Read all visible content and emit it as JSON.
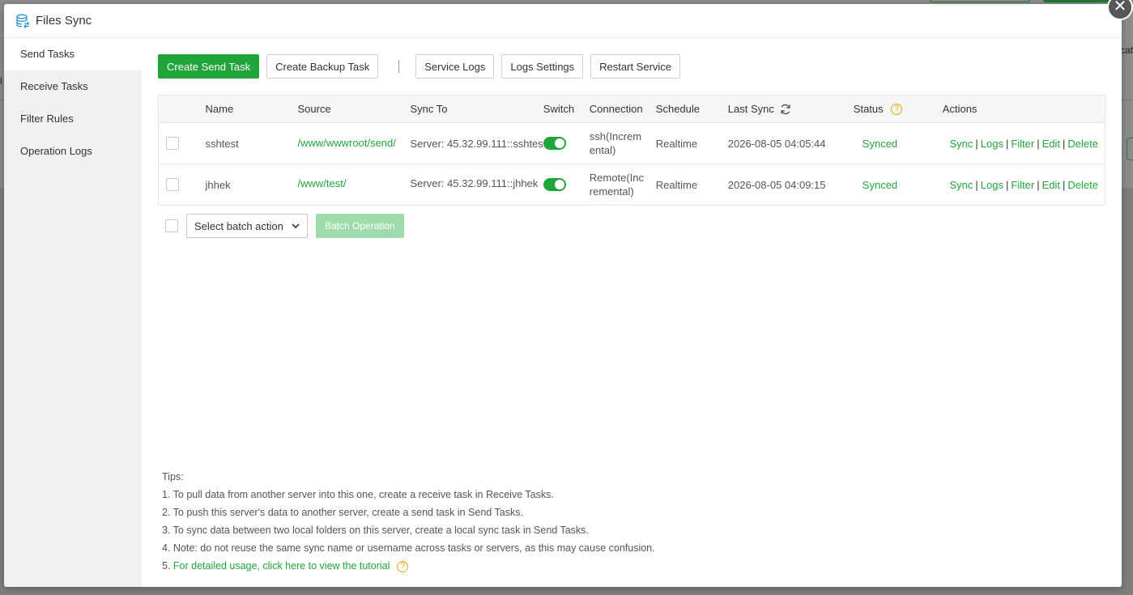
{
  "background": {
    "left_fragment": "l",
    "right_fragment": "cat"
  },
  "dialog": {
    "title": "Files Sync",
    "close_glyph": "✕"
  },
  "sidebar": {
    "items": [
      {
        "label": "Send Tasks"
      },
      {
        "label": "Receive Tasks"
      },
      {
        "label": "Filter Rules"
      },
      {
        "label": "Operation Logs"
      }
    ]
  },
  "toolbar": {
    "create_send": "Create Send Task",
    "create_backup": "Create Backup Task",
    "service_logs": "Service Logs",
    "logs_settings": "Logs Settings",
    "restart_service": "Restart Service"
  },
  "table": {
    "columns": {
      "name": "Name",
      "source": "Source",
      "sync_to": "Sync To",
      "switch": "Switch",
      "connection": "Connection",
      "schedule": "Schedule",
      "last_sync": "Last Sync",
      "status": "Status",
      "actions": "Actions"
    },
    "rows": [
      {
        "name": "sshtest",
        "source": "/www/wwwroot/send/",
        "sync_to": "Server: 45.32.99.111::sshtes",
        "switch_on": true,
        "connection_l1": "ssh(Increm",
        "connection_l2": "ental)",
        "schedule": "Realtime",
        "last_sync": "2026-08-05 04:05:44",
        "status": "Synced"
      },
      {
        "name": "jhhek",
        "source": "/www/test/",
        "sync_to": "Server: 45.32.99.111::jhhek",
        "switch_on": true,
        "connection_l1": "Remote(Inc",
        "connection_l2": "remental)",
        "schedule": "Realtime",
        "last_sync": "2026-08-05 04:09:15",
        "status": "Synced"
      }
    ],
    "action_labels": {
      "sync": "Sync",
      "logs": "Logs",
      "filter": "Filter",
      "edit": "Edit",
      "delete": "Delete",
      "separator": "|"
    }
  },
  "batch": {
    "select_placeholder": "Select batch action",
    "button": "Batch Operation"
  },
  "tips": {
    "heading": "Tips:",
    "items": [
      "1. To pull data from another server into this one, create a receive task in Receive Tasks.",
      "2. To push this server's data to another server, create a send task in Send Tasks.",
      "3. To sync data between two local folders on this server, create a local sync task in Send Tasks.",
      "4. Note: do not reuse the same sync name or username across tasks or servers, as this may cause confusion."
    ],
    "link_prefix": "5. ",
    "link_text": "For detailed usage, click here to view the tutorial"
  },
  "colors": {
    "accent": "#20a53a",
    "warning": "#f0a20a",
    "disabled_accent": "#9fdcab"
  },
  "icons": {
    "title": "database-icon",
    "refresh": "refresh-icon",
    "help": "question-circle-icon",
    "dropdown": "chevron-down-icon"
  }
}
